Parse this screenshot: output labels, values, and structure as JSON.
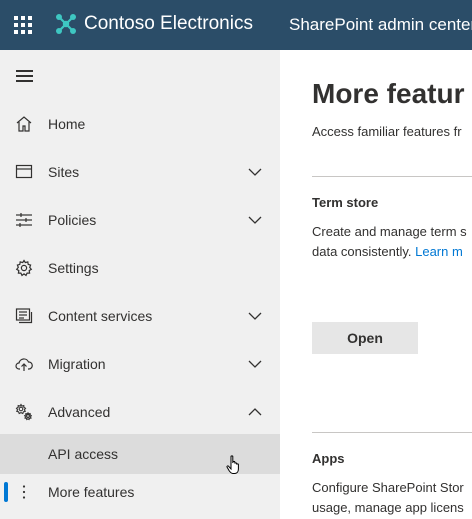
{
  "topbar": {
    "brand": "Contoso Electronics",
    "app_name": "SharePoint admin center",
    "icons": [
      "waffle-icon",
      "contoso-logo"
    ]
  },
  "sidebar": {
    "items": [
      {
        "label": "Home",
        "icon": "home-icon",
        "expandable": false
      },
      {
        "label": "Sites",
        "icon": "sites-icon",
        "expandable": true,
        "expanded": false
      },
      {
        "label": "Policies",
        "icon": "policies-icon",
        "expandable": true,
        "expanded": false
      },
      {
        "label": "Settings",
        "icon": "gear-icon",
        "expandable": false
      },
      {
        "label": "Content services",
        "icon": "content-services-icon",
        "expandable": true,
        "expanded": false
      },
      {
        "label": "Migration",
        "icon": "cloud-upload-icon",
        "expandable": true,
        "expanded": false
      },
      {
        "label": "Advanced",
        "icon": "advanced-settings-icon",
        "expandable": true,
        "expanded": true
      },
      {
        "label": "API access",
        "sub": true
      },
      {
        "label": "More features",
        "icon": "more-vertical-icon",
        "selected": true
      }
    ]
  },
  "main": {
    "title": "More featur",
    "description": "Access familiar features fr",
    "cards": [
      {
        "title": "Term store",
        "desc_line1": "Create and manage term s",
        "desc_line2": "data consistently.",
        "link": "Learn m",
        "button": "Open"
      },
      {
        "title": "Apps",
        "desc_line1": "Configure SharePoint Stor",
        "desc_line2": "usage, manage app licens"
      }
    ]
  },
  "colors": {
    "topbar": "#2b4d68",
    "sidebar": "#f0f0f0",
    "accent": "#0078d4",
    "highlight": "#dcdcdc"
  }
}
